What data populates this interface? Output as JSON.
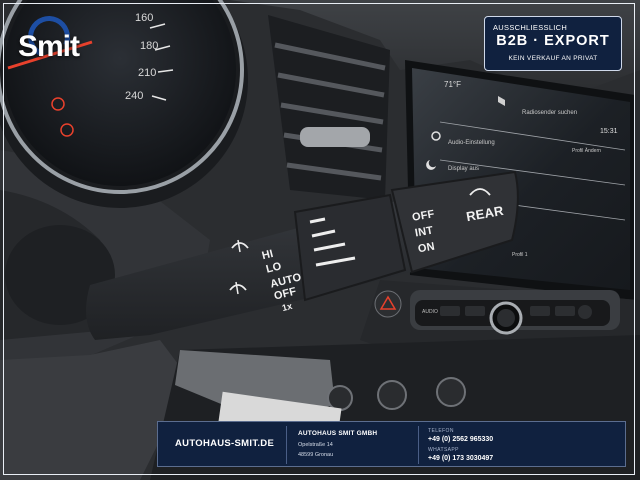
{
  "logo": {
    "brand": "Smit"
  },
  "badge": {
    "top": "AUSSCHLIESSLICH",
    "main": "B2B  ·  EXPORT",
    "sub": "KEIN VERKAUF AN PRIVAT"
  },
  "speedometer": {
    "marks": [
      "160",
      "180",
      "210",
      "240"
    ]
  },
  "screen": {
    "temp": "71°F",
    "time": "15:31",
    "title": "Radiosender suchen",
    "item1": "Audio-Einstellung",
    "item2": "Display aus",
    "side1": "Profil Ändern",
    "side2": "Profil 1"
  },
  "stalk": {
    "wiper_hi": "HI",
    "wiper_lo": "LO",
    "wiper_auto": "AUTO",
    "wiper_off": "OFF",
    "wiper_1x": "1x",
    "rear_off": "OFF",
    "rear_int": "INT",
    "rear_on": "ON",
    "rear": "REAR"
  },
  "console": {
    "btn_audio": "AUDIO"
  },
  "footer": {
    "website": "AUTOHAUS-SMIT.DE",
    "company": "AUTOHAUS SMIT GMBH",
    "street": "Opelstraße 14",
    "city": "48599 Gronau",
    "phone_label": "TELEFON",
    "phone": "+49 (0) 2562 965330",
    "whatsapp_label": "WHATSAPP",
    "whatsapp": "+49 (0) 173 3030497"
  },
  "colors": {
    "brand_navy": "#10213f",
    "brand_blue": "#1d4ea3",
    "logo_red": "#e02020",
    "warning_red": "#e8412c"
  }
}
